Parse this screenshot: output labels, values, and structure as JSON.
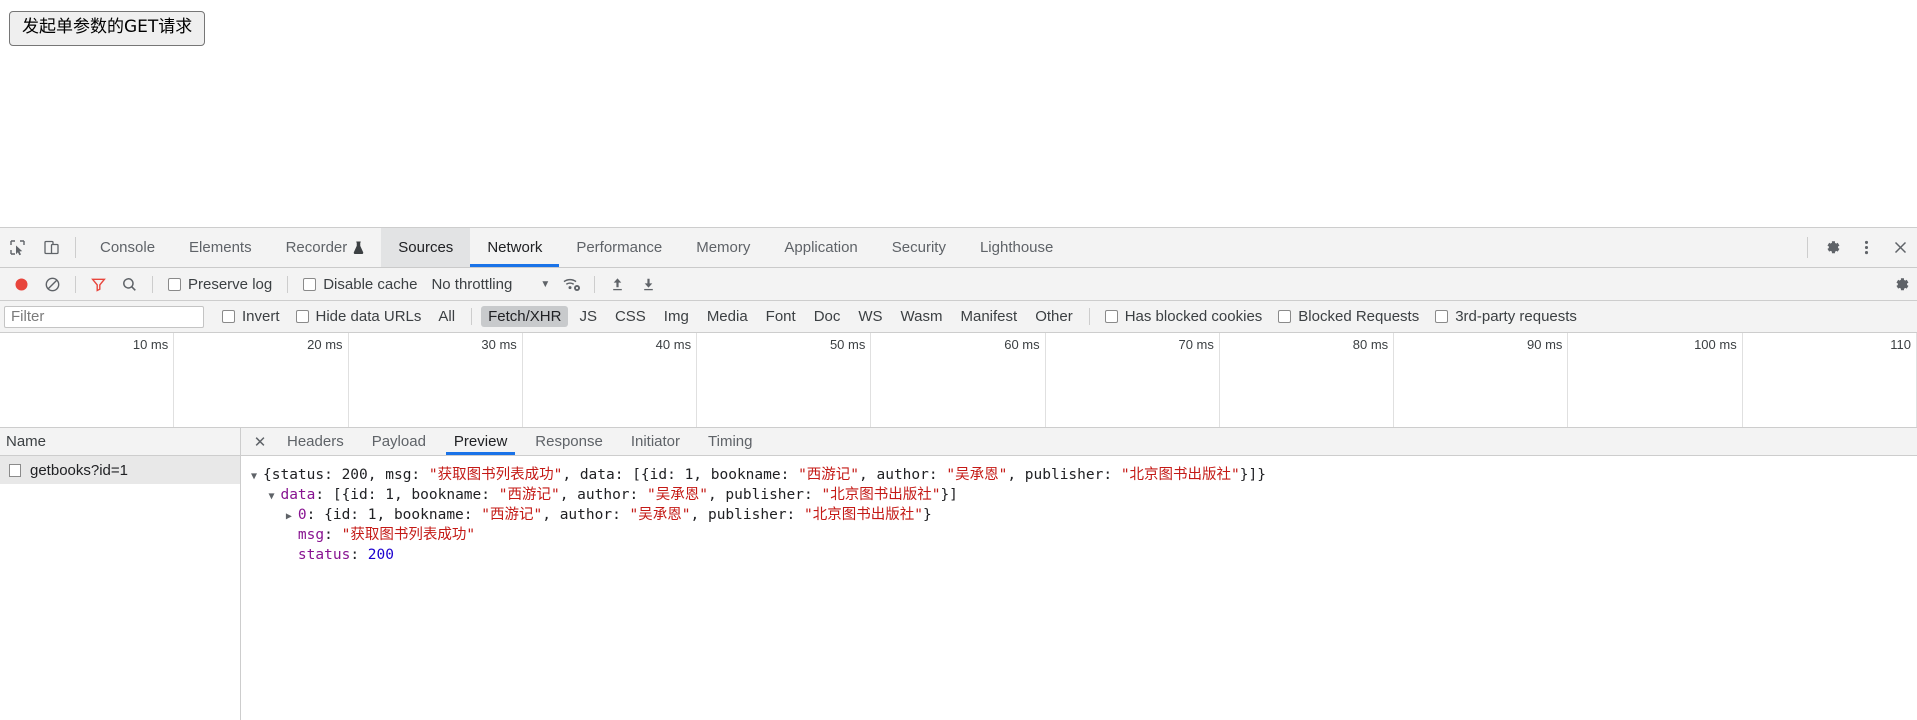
{
  "page": {
    "trigger_button_label": "发起单参数的GET请求"
  },
  "devtools": {
    "tabstrip": {
      "inspect_icon": "inspect-element-icon",
      "device_icon": "device-toolbar-icon",
      "tabs": [
        {
          "label": "Console",
          "state": "normal"
        },
        {
          "label": "Elements",
          "state": "normal"
        },
        {
          "label": "Recorder",
          "state": "normal",
          "extra_icon": "flask-icon"
        },
        {
          "label": "Sources",
          "state": "selected-gray"
        },
        {
          "label": "Network",
          "state": "selected-blue"
        },
        {
          "label": "Performance",
          "state": "normal"
        },
        {
          "label": "Memory",
          "state": "normal"
        },
        {
          "label": "Application",
          "state": "normal"
        },
        {
          "label": "Security",
          "state": "normal"
        },
        {
          "label": "Lighthouse",
          "state": "normal"
        }
      ],
      "right_icons": [
        "gear-icon",
        "kebab-menu-icon",
        "close-icon"
      ]
    },
    "network_toolbar": {
      "record_icon": "record-stop-icon",
      "record_color": "#e8453c",
      "clear_icon": "clear-icon",
      "filter_icon": "filter-funnel-icon",
      "filter_icon_color": "#e8453c",
      "search_icon": "search-icon",
      "preserve_log": {
        "label": "Preserve log",
        "checked": false
      },
      "disable_cache": {
        "label": "Disable cache",
        "checked": false
      },
      "throttling": {
        "value": "No throttling",
        "caret": "▼"
      },
      "wifi_icon": "network-conditions-icon",
      "import_icon": "import-har-icon",
      "export_icon": "export-har-icon",
      "settings_icon": "gear-icon"
    },
    "filter_row": {
      "filter_placeholder": "Filter",
      "filter_value": "",
      "invert": {
        "label": "Invert",
        "checked": false
      },
      "hide_data_urls": {
        "label": "Hide data URLs",
        "checked": false
      },
      "types": [
        {
          "label": "All",
          "active": false
        },
        {
          "label": "Fetch/XHR",
          "active": true
        },
        {
          "label": "JS",
          "active": false
        },
        {
          "label": "CSS",
          "active": false
        },
        {
          "label": "Img",
          "active": false
        },
        {
          "label": "Media",
          "active": false
        },
        {
          "label": "Font",
          "active": false
        },
        {
          "label": "Doc",
          "active": false
        },
        {
          "label": "WS",
          "active": false
        },
        {
          "label": "Wasm",
          "active": false
        },
        {
          "label": "Manifest",
          "active": false
        },
        {
          "label": "Other",
          "active": false
        }
      ],
      "has_blocked_cookies": {
        "label": "Has blocked cookies",
        "checked": false
      },
      "blocked_requests": {
        "label": "Blocked Requests",
        "checked": false
      },
      "third_party_requests": {
        "label": "3rd-party requests",
        "checked": false
      }
    },
    "timeline": {
      "ticks": [
        "10 ms",
        "20 ms",
        "30 ms",
        "40 ms",
        "50 ms",
        "60 ms",
        "70 ms",
        "80 ms",
        "90 ms",
        "100 ms",
        "110"
      ]
    },
    "request_list": {
      "column_header": "Name",
      "rows": [
        {
          "name": "getbooks?id=1",
          "selected": true
        }
      ]
    },
    "detail": {
      "close_glyph": "✕",
      "tabs": [
        {
          "label": "Headers",
          "active": false
        },
        {
          "label": "Payload",
          "active": false
        },
        {
          "label": "Preview",
          "active": true
        },
        {
          "label": "Response",
          "active": false
        },
        {
          "label": "Initiator",
          "active": false
        },
        {
          "label": "Timing",
          "active": false
        }
      ],
      "preview_lines": [
        {
          "triangle": "▼",
          "indent": 0,
          "tokens": [
            {
              "t": "{status: ",
              "c": "plain"
            },
            {
              "t": "200",
              "c": "plain"
            },
            {
              "t": ", msg: ",
              "c": "plain"
            },
            {
              "t": "\"获取图书列表成功\"",
              "c": "red"
            },
            {
              "t": ", data: [{id: 1, bookname: ",
              "c": "plain"
            },
            {
              "t": "\"西游记\"",
              "c": "red"
            },
            {
              "t": ", author: ",
              "c": "plain"
            },
            {
              "t": "\"吴承恩\"",
              "c": "red"
            },
            {
              "t": ", publisher: ",
              "c": "plain"
            },
            {
              "t": "\"北京图书出版社\"",
              "c": "red"
            },
            {
              "t": "}]}",
              "c": "plain"
            }
          ]
        },
        {
          "triangle": "▼",
          "indent": 1,
          "tokens": [
            {
              "t": "data",
              "c": "purple"
            },
            {
              "t": ": [{id: 1, bookname: ",
              "c": "plain"
            },
            {
              "t": "\"西游记\"",
              "c": "red"
            },
            {
              "t": ", author: ",
              "c": "plain"
            },
            {
              "t": "\"吴承恩\"",
              "c": "red"
            },
            {
              "t": ", publisher: ",
              "c": "plain"
            },
            {
              "t": "\"北京图书出版社\"",
              "c": "red"
            },
            {
              "t": "}]",
              "c": "plain"
            }
          ]
        },
        {
          "triangle": "▶",
          "indent": 2,
          "tokens": [
            {
              "t": "0",
              "c": "purple"
            },
            {
              "t": ": {id: 1, bookname: ",
              "c": "plain"
            },
            {
              "t": "\"西游记\"",
              "c": "red"
            },
            {
              "t": ", author: ",
              "c": "plain"
            },
            {
              "t": "\"吴承恩\"",
              "c": "red"
            },
            {
              "t": ", publisher: ",
              "c": "plain"
            },
            {
              "t": "\"北京图书出版社\"",
              "c": "red"
            },
            {
              "t": "}",
              "c": "plain"
            }
          ]
        },
        {
          "triangle": "",
          "indent": 2,
          "tokens": [
            {
              "t": "msg",
              "c": "purple"
            },
            {
              "t": ": ",
              "c": "plain"
            },
            {
              "t": "\"获取图书列表成功\"",
              "c": "red"
            }
          ]
        },
        {
          "triangle": "",
          "indent": 2,
          "tokens": [
            {
              "t": "status",
              "c": "purple"
            },
            {
              "t": ": ",
              "c": "plain"
            },
            {
              "t": "200",
              "c": "blue"
            }
          ]
        }
      ]
    }
  }
}
